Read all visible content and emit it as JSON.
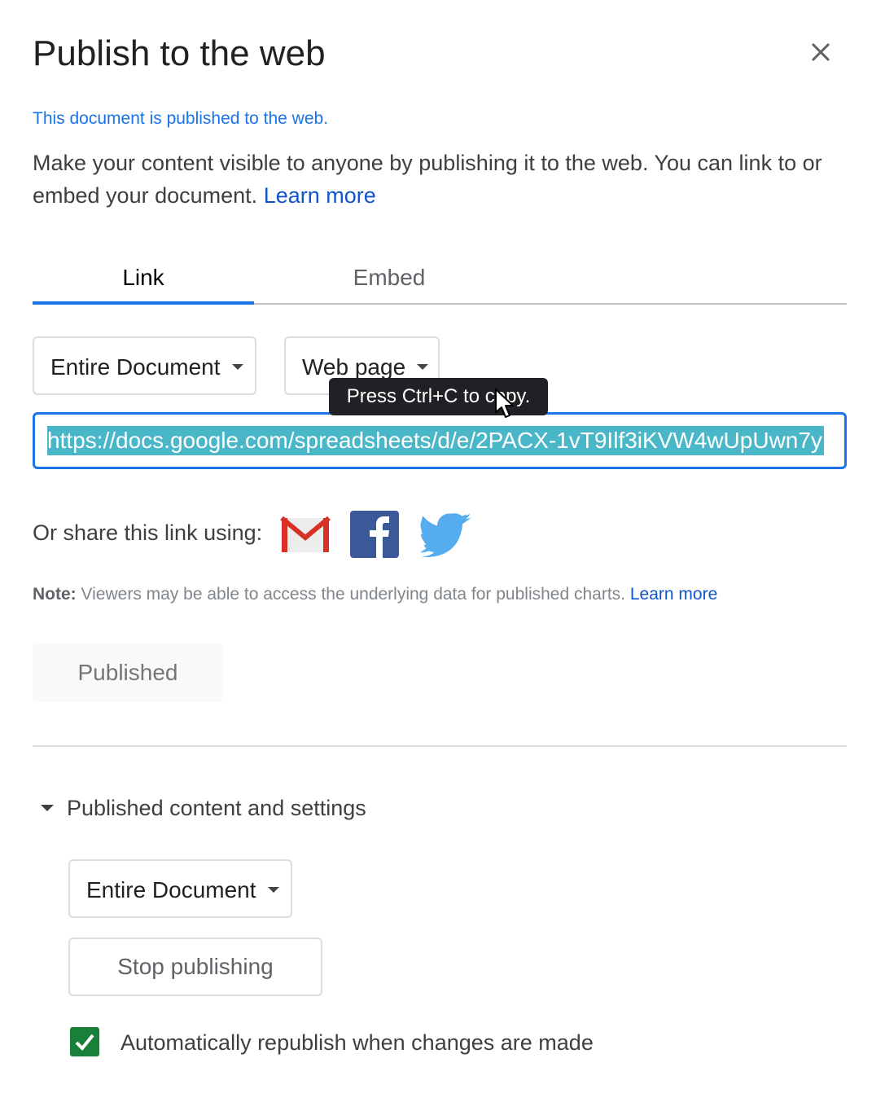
{
  "dialog": {
    "title": "Publish to the web",
    "close_icon": "close-icon",
    "status": "This document is published to the web.",
    "description": "Make your content visible to anyone by publishing it to the web. You can link to or embed your document.",
    "learn_more": "Learn more"
  },
  "tabs": [
    {
      "label": "Link",
      "active": true
    },
    {
      "label": "Embed",
      "active": false
    }
  ],
  "link_options": {
    "scope_select": "Entire Document",
    "format_select": "Web page"
  },
  "url_field": {
    "value": "https://docs.google.com/spreadsheets/d/e/2PACX-1vT9Ilf3iKVW4wUpUwn7y",
    "selected": true
  },
  "tooltip": "Press Ctrl+C to copy.",
  "share": {
    "label": "Or share this link using:",
    "icons": [
      "gmail-icon",
      "facebook-icon",
      "twitter-icon"
    ]
  },
  "note": {
    "prefix": "Note:",
    "text": "Viewers may be able to access the underlying data for published charts.",
    "link": "Learn more"
  },
  "published_button": "Published",
  "settings": {
    "header": "Published content and settings",
    "expanded": true,
    "scope_select": "Entire Document",
    "stop_button": "Stop publishing",
    "auto_republish_label": "Automatically republish when changes are made",
    "auto_republish_checked": true
  },
  "colors": {
    "accent": "#1a73e8",
    "link": "#1155cc",
    "checkbox": "#188038",
    "selection": "#4ab7c8"
  }
}
